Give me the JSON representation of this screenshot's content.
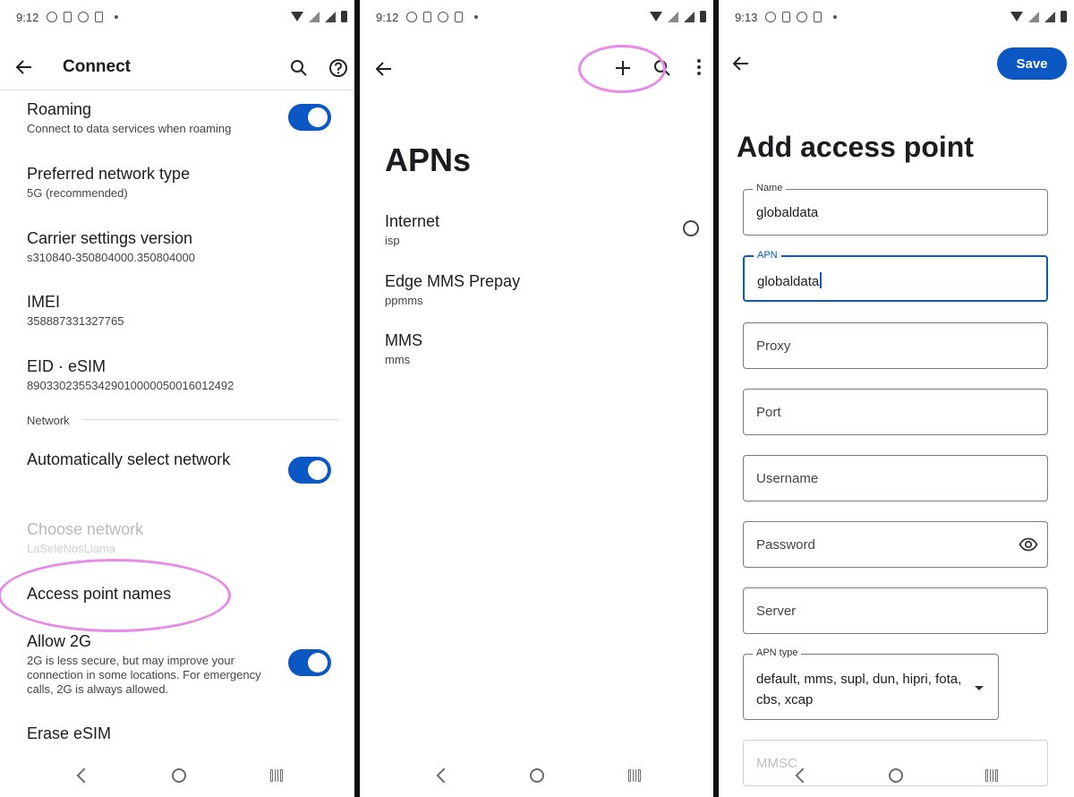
{
  "panel1": {
    "status_time": "9:12",
    "title": "Connect",
    "items": [
      {
        "title": "Roaming",
        "subtitle": "Connect to data services when roaming"
      },
      {
        "title": "Preferred network type",
        "subtitle": "5G (recommended)"
      },
      {
        "title": "Carrier settings version",
        "subtitle": "s310840-350804000.350804000"
      },
      {
        "title": "IMEI",
        "subtitle": "358887331327765"
      },
      {
        "title": "EID · eSIM",
        "subtitle": "89033023553429010000050016012492"
      }
    ],
    "section_network": "Network",
    "auto_select": {
      "title": "Automatically select network"
    },
    "choose_network": {
      "title": "Choose network",
      "subtitle": "LaSeleNosLlama"
    },
    "access_point_names": {
      "title": "Access point names"
    },
    "allow_2g": {
      "title": "Allow 2G",
      "subtitle": "2G is less secure, but may improve your connection in some locations. For emergency calls, 2G is always allowed."
    },
    "erase_esim": {
      "title": "Erase eSIM"
    }
  },
  "panel2": {
    "status_time": "9:12",
    "title": "APNs",
    "apns": [
      {
        "name": "Internet",
        "apn": "isp"
      },
      {
        "name": "Edge MMS Prepay",
        "apn": "ppmms"
      },
      {
        "name": "MMS",
        "apn": "mms"
      }
    ]
  },
  "panel3": {
    "status_time": "9:13",
    "save_label": "Save",
    "title": "Add access point",
    "fields": {
      "name": {
        "label": "Name",
        "value": "globaldata"
      },
      "apn": {
        "label": "APN",
        "value": "globaldata"
      },
      "proxy": {
        "placeholder": "Proxy"
      },
      "port": {
        "placeholder": "Port"
      },
      "username": {
        "placeholder": "Username"
      },
      "password": {
        "placeholder": "Password"
      },
      "server": {
        "placeholder": "Server"
      },
      "apn_type": {
        "label": "APN type",
        "value": "default, mms, supl, dun, hipri, fota, cbs, xcap"
      },
      "mmsc": {
        "placeholder": "MMSC"
      }
    }
  },
  "colors": {
    "accent": "#0b57c4",
    "highlight": "#e58be8"
  }
}
